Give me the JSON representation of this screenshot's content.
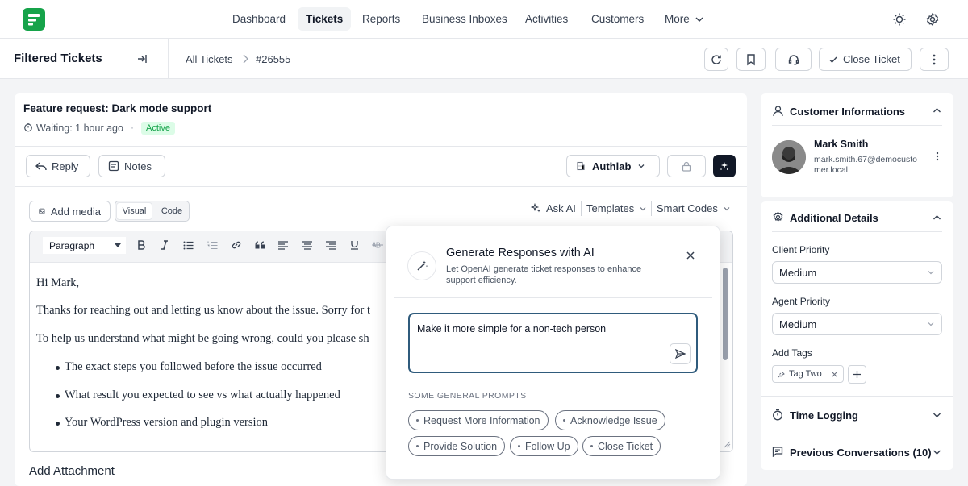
{
  "nav": {
    "items": [
      "Dashboard",
      "Tickets",
      "Reports",
      "Business Inboxes",
      "Activities",
      "Customers"
    ],
    "more_label": "More"
  },
  "subheader": {
    "title": "Filtered Tickets",
    "breadcrumb_root": "All Tickets",
    "ticket_id": "#26555",
    "close_ticket_label": "Close Ticket"
  },
  "ticket": {
    "subject": "Feature request: Dark mode support",
    "waiting": "Waiting: 1 hour ago",
    "status": "Active",
    "reply_label": "Reply",
    "notes_label": "Notes",
    "mailbox": "Authlab"
  },
  "editor": {
    "add_media_label": "Add media",
    "tab_visual": "Visual",
    "tab_code": "Code",
    "ask_ai_label": "Ask AI",
    "templates_label": "Templates",
    "smart_codes_label": "Smart Codes",
    "format_select": "Paragraph",
    "body": {
      "greeting": "Hi Mark,",
      "para1": "Thanks for reaching out and letting us know about the issue. Sorry for t",
      "para2": "To help us understand what might be going wrong, could you please sh",
      "bullets": [
        "The exact steps you followed before the issue occurred",
        "What result you expected to see vs what actually happened",
        "Your WordPress version and plugin version"
      ]
    },
    "add_attachment_label": "Add Attachment"
  },
  "ai_popup": {
    "title": "Generate Responses with AI",
    "description_line1": "Let OpenAI generate ticket responses to enhance",
    "description_line2": "support efficiency.",
    "prompt_value": "Make it more simple for a non-tech person",
    "prompts_heading": "SOME GENERAL PROMPTS",
    "prompts": [
      "Request More Information",
      "Acknowledge Issue",
      "Provide Solution",
      "Follow Up",
      "Close Ticket"
    ]
  },
  "sidebar": {
    "customer_section": "Customer Informations",
    "customer_name": "Mark Smith",
    "customer_email_line1": "mark.smith.67@democusto",
    "customer_email_line2": "mer.local",
    "details_section": "Additional Details",
    "client_priority_label": "Client Priority",
    "client_priority_value": "Medium",
    "agent_priority_label": "Agent Priority",
    "agent_priority_value": "Medium",
    "add_tags_label": "Add Tags",
    "tag": "Tag Two",
    "time_logging": "Time Logging",
    "previous_conversations": "Previous Conversations (10)"
  },
  "colors": {
    "brand": "#16a34a",
    "active_badge_bg": "#dcfce7",
    "active_badge_text": "#16a34a",
    "ai_input_border": "#2f5b7c"
  }
}
